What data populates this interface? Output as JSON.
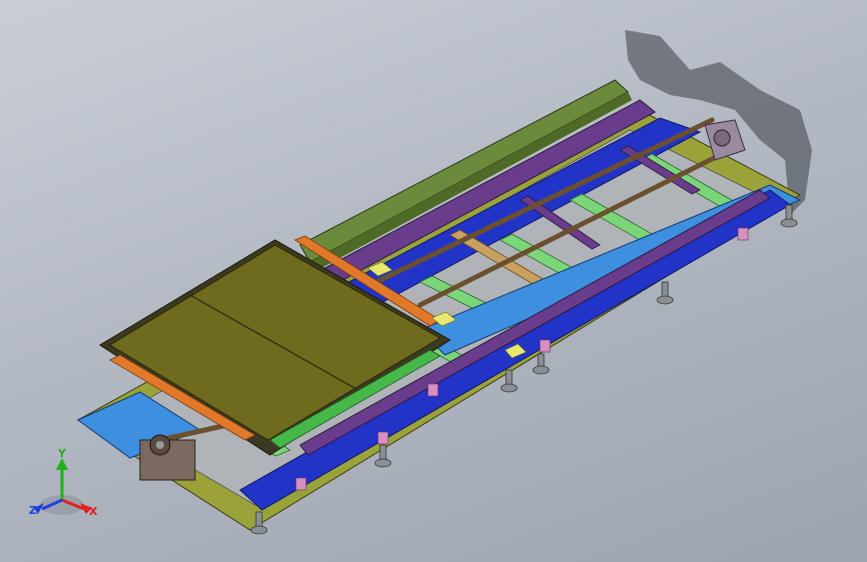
{
  "viewport": {
    "background_top": "#c9ced6",
    "background_bottom": "#9da4af"
  },
  "model": {
    "description_icon": "cad-assembly-conveyor-frame-isometric",
    "colors": {
      "frame_base": "#9aa23a",
      "side_rail_green": "#6c8a3c",
      "blue_rail": "#2233c8",
      "light_blue_plate": "#3f8fe0",
      "purple_beam": "#6a3d8c",
      "light_green_bar": "#7bd67a",
      "platform_olive": "#6e6a1e",
      "orange_bar": "#e07a2a",
      "drive_rod_brown": "#6b5030",
      "feet_grey": "#8a8f96",
      "shadow": "#3a3f44"
    }
  },
  "triad": {
    "axis_y_label": "Y",
    "axis_x_label": "X",
    "axis_z_label": "Z",
    "colors": {
      "x": "#e02020",
      "y": "#20b020",
      "z": "#2040e0"
    }
  }
}
